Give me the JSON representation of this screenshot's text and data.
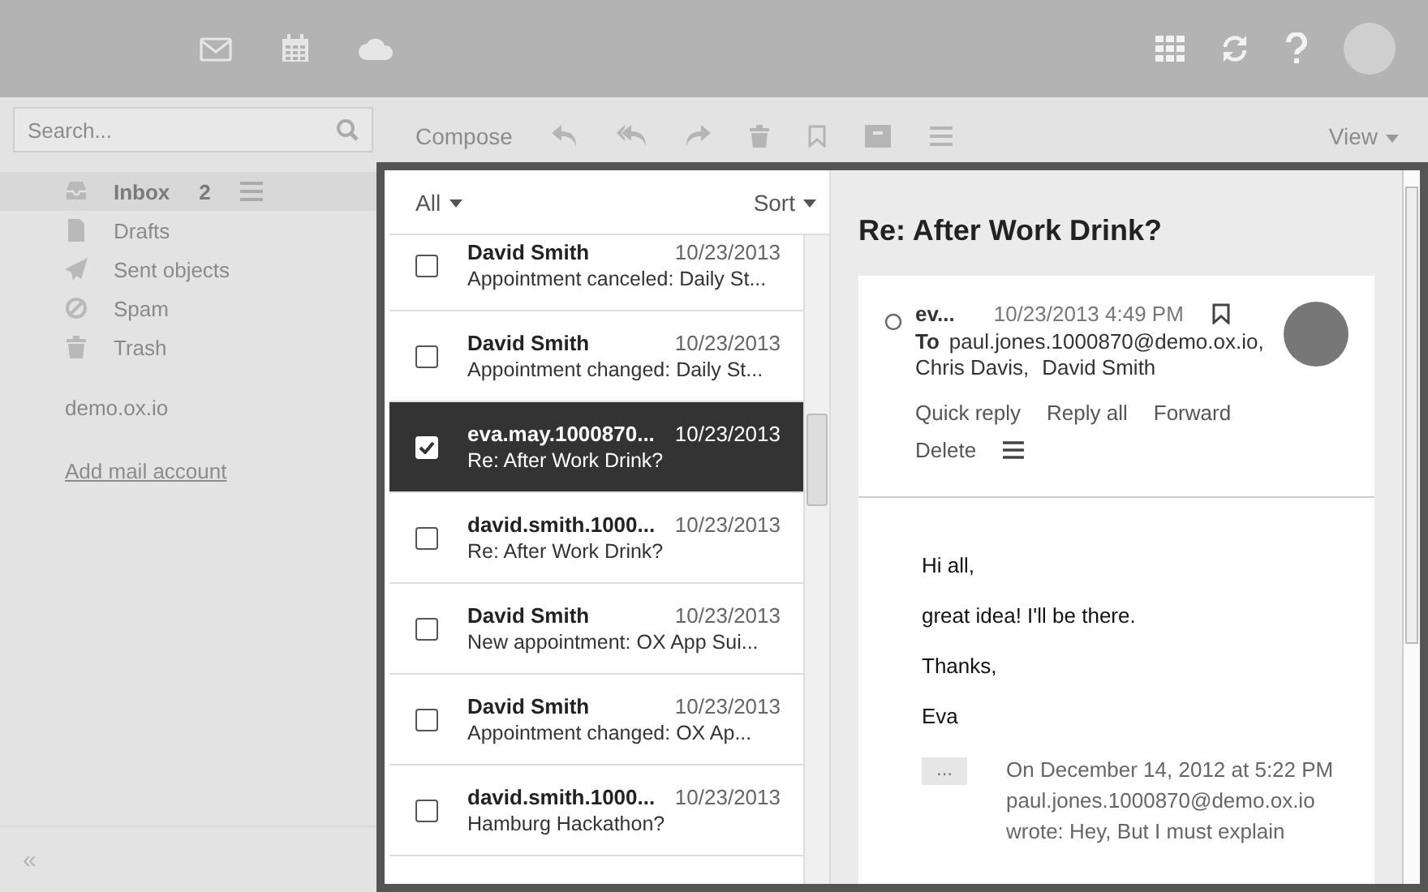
{
  "search": {
    "placeholder": "Search..."
  },
  "toolbar": {
    "compose": "Compose",
    "view": "View"
  },
  "folders": [
    {
      "kind": "inbox",
      "label": "Inbox",
      "count": "2",
      "selected": true
    },
    {
      "kind": "drafts",
      "label": "Drafts",
      "selected": false
    },
    {
      "kind": "sent",
      "label": "Sent objects",
      "selected": false
    },
    {
      "kind": "spam",
      "label": "Spam",
      "selected": false
    },
    {
      "kind": "trash",
      "label": "Trash",
      "selected": false
    }
  ],
  "account": "demo.ox.io",
  "add_account": "Add mail account",
  "collapse": "«",
  "list": {
    "filter": "All",
    "sort": "Sort",
    "rows": [
      {
        "sender": "David Smith",
        "date": "10/23/2013",
        "subject": "Appointment canceled: Daily St...",
        "checked": false,
        "selected": false
      },
      {
        "sender": "David Smith",
        "date": "10/23/2013",
        "subject": "Appointment changed: Daily St...",
        "checked": false,
        "selected": false
      },
      {
        "sender": "eva.may.1000870...",
        "date": "10/23/2013",
        "subject": "Re: After Work Drink?",
        "checked": true,
        "selected": true
      },
      {
        "sender": "david.smith.1000...",
        "date": "10/23/2013",
        "subject": "Re: After Work Drink?",
        "checked": false,
        "selected": false
      },
      {
        "sender": "David Smith",
        "date": "10/23/2013",
        "subject": "New appointment: OX App Sui...",
        "checked": false,
        "selected": false
      },
      {
        "sender": "David Smith",
        "date": "10/23/2013",
        "subject": "Appointment changed: OX Ap...",
        "checked": false,
        "selected": false
      },
      {
        "sender": "david.smith.1000...",
        "date": "10/23/2013",
        "subject": "Hamburg Hackathon?",
        "checked": false,
        "selected": false
      }
    ]
  },
  "message": {
    "title": "Re: After Work Drink?",
    "sender": "ev...",
    "date": "10/23/2013 4:49 PM",
    "to_label": "To",
    "recipients": [
      "paul.jones.1000870@demo.ox.io,",
      "Chris Davis,",
      "David Smith"
    ],
    "actions": [
      "Quick reply",
      "Reply all",
      "Forward",
      "Delete"
    ],
    "body": [
      "Hi all,",
      "great idea! I'll be there.",
      "Thanks,",
      "Eva"
    ],
    "quote_toggle": "...",
    "quote": "On December 14, 2012 at 5:22 PM paul.jones.1000870@demo.ox.io wrote: Hey, But I must explain"
  }
}
